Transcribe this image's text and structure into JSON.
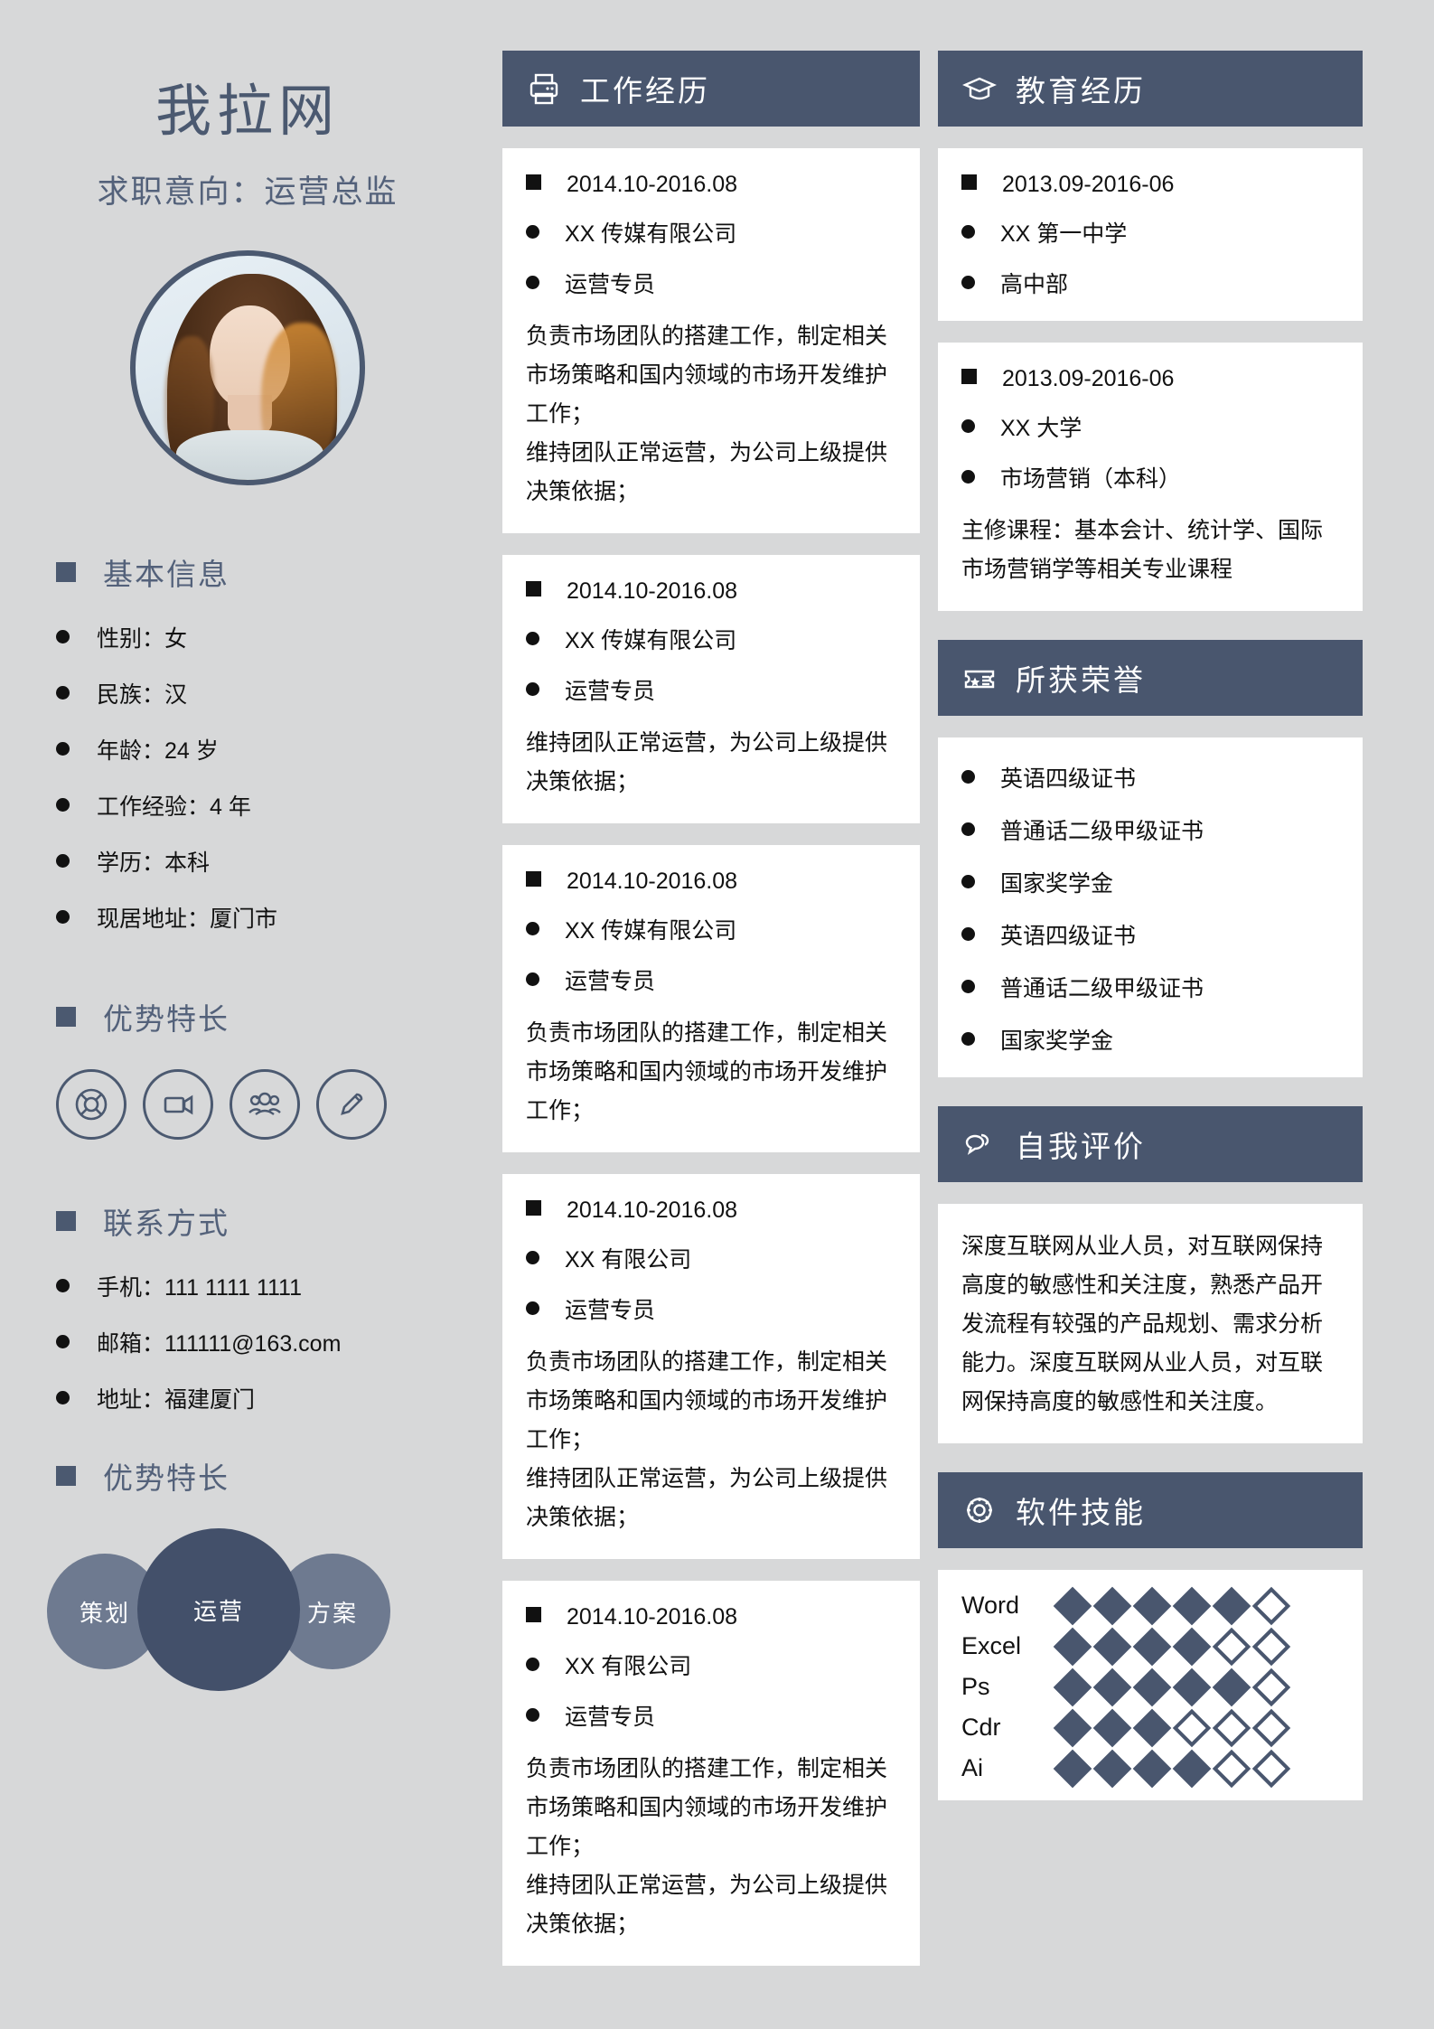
{
  "profile": {
    "name": "我拉网",
    "objective": "求职意向：运营总监",
    "photo_alt": "profile-photo"
  },
  "sidebar": {
    "basic_info": {
      "title": "基本信息",
      "items": [
        "性别：女",
        "民族：汉",
        "年龄：24 岁",
        "工作经验：4 年",
        "学历：本科",
        "现居地址：厦门市"
      ]
    },
    "strengths": {
      "title": "优势特长",
      "icons": [
        "lifebuoy-icon",
        "video-camera-icon",
        "people-group-icon",
        "pen-icon"
      ]
    },
    "contact": {
      "title": "联系方式",
      "items": [
        "手机：111 1111 1111",
        "邮箱：111111@163.com",
        "地址：福建厦门"
      ]
    },
    "strengths2": {
      "title": "优势特长",
      "bubbles": [
        "策划",
        "运营",
        "方案"
      ]
    }
  },
  "work": {
    "title": "工作经历",
    "icon": "printer-icon",
    "entries": [
      {
        "period": "2014.10-2016.08",
        "company": "XX 传媒有限公司",
        "role": "运营专员",
        "desc": [
          "负责市场团队的搭建工作，制定相关市场策略和国内领域的市场开发维护工作；",
          "维持团队正常运营，为公司上级提供决策依据；"
        ]
      },
      {
        "period": "2014.10-2016.08",
        "company": "XX 传媒有限公司",
        "role": "运营专员",
        "desc": [
          "维持团队正常运营，为公司上级提供决策依据；"
        ]
      },
      {
        "period": "2014.10-2016.08",
        "company": "XX 传媒有限公司",
        "role": "运营专员",
        "desc": [
          "负责市场团队的搭建工作，制定相关市场策略和国内领域的市场开发维护工作；"
        ]
      },
      {
        "period": "2014.10-2016.08",
        "company": "XX 有限公司",
        "role": "运营专员",
        "desc": [
          "负责市场团队的搭建工作，制定相关市场策略和国内领域的市场开发维护工作；",
          "维持团队正常运营，为公司上级提供决策依据；"
        ]
      },
      {
        "period": "2014.10-2016.08",
        "company": "XX 有限公司",
        "role": "运营专员",
        "desc": [
          "负责市场团队的搭建工作，制定相关市场策略和国内领域的市场开发维护工作；",
          "维持团队正常运营，为公司上级提供决策依据；"
        ]
      }
    ]
  },
  "education": {
    "title": "教育经历",
    "icon": "graduation-cap-icon",
    "entries": [
      {
        "period": "2013.09-2016-06",
        "school": "XX 第一中学",
        "dept": "高中部",
        "courses": ""
      },
      {
        "period": "2013.09-2016-06",
        "school": "XX 大学",
        "dept": "市场营销（本科）",
        "courses": "主修课程：基本会计、统计学、国际市场营销学等相关专业课程"
      }
    ]
  },
  "honors": {
    "title": "所获荣誉",
    "icon": "ticket-icon",
    "items": [
      "英语四级证书",
      "普通话二级甲级证书",
      "国家奖学金",
      "英语四级证书",
      "普通话二级甲级证书",
      "国家奖学金"
    ]
  },
  "self_eval": {
    "title": "自我评价",
    "icon": "speech-bubble-icon",
    "text": "深度互联网从业人员，对互联网保持高度的敏感性和关注度，熟悉产品开发流程有较强的产品规划、需求分析能力。深度互联网从业人员，对互联网保持高度的敏感性和关注度。"
  },
  "software": {
    "title": "软件技能",
    "icon": "gear-icon",
    "max": 6,
    "skills": [
      {
        "name": "Word",
        "level": 5
      },
      {
        "name": "Excel",
        "level": 4
      },
      {
        "name": "Ps",
        "level": 5
      },
      {
        "name": "Cdr",
        "level": 3
      },
      {
        "name": "Ai",
        "level": 4
      }
    ]
  },
  "colors": {
    "page_bg": "#d7d8d9",
    "accent_dark": "#49566e",
    "accent_mid": "#6e7a90",
    "accent_deep": "#43506a",
    "card_bg": "#ffffff",
    "heading_text": "#53617a"
  }
}
